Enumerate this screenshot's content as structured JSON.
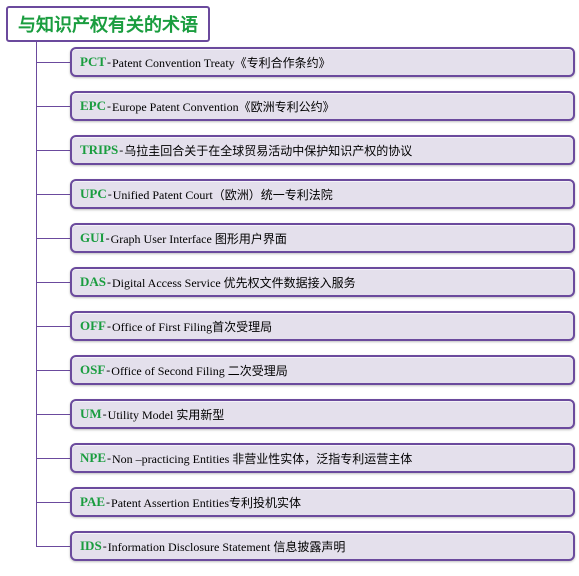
{
  "title": "与知识产权有关的术语",
  "colors": {
    "purple": "#6b4a9d",
    "green": "#1a9d3f",
    "box_bg": "#e4e0ec"
  },
  "items": [
    {
      "abbr": "PCT",
      "sep": "- ",
      "desc": "Patent Convention Treaty《专利合作条约》"
    },
    {
      "abbr": "EPC",
      "sep": "- ",
      "desc": "Europe Patent Convention《欧洲专利公约》"
    },
    {
      "abbr": "TRIPS",
      "sep": "-",
      "desc": "乌拉圭回合关于在全球贸易活动中保护知识产权的协议"
    },
    {
      "abbr": "UPC",
      "sep": "-",
      "desc": "Unified Patent Court（欧洲）统一专利法院"
    },
    {
      "abbr": "GUI",
      "sep": "-",
      "desc": "Graph User Interface 图形用户界面"
    },
    {
      "abbr": "DAS",
      "sep": "-",
      "desc": "Digital Access Service 优先权文件数据接入服务"
    },
    {
      "abbr": "OFF",
      "sep": "-",
      "desc": "Office of First Filing首次受理局"
    },
    {
      "abbr": "OSF",
      "sep": "-",
      "desc": "Office of Second Filing 二次受理局"
    },
    {
      "abbr": "UM",
      "sep": "-",
      "desc": "Utility Model 实用新型"
    },
    {
      "abbr": "NPE",
      "sep": " - ",
      "desc": "Non –practicing Entities 非营业性实体，泛指专利运营主体"
    },
    {
      "abbr": "PAE",
      "sep": "-",
      "desc": "Patent Assertion Entities专利投机实体"
    },
    {
      "abbr": "IDS",
      "sep": "-",
      "desc": "Information Disclosure Statement 信息披露声明"
    }
  ]
}
